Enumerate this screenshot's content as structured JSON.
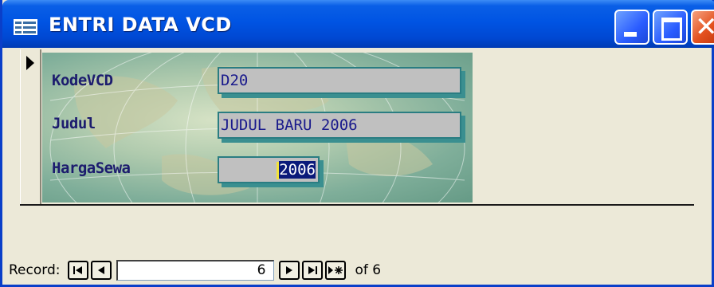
{
  "window": {
    "title": "ENTRI DATA VCD",
    "icon": "form-icon",
    "controls": [
      "minimize",
      "maximize",
      "close"
    ]
  },
  "form": {
    "fields": [
      {
        "label": "KodeVCD",
        "value": "D20"
      },
      {
        "label": "Judul",
        "value": "JUDUL BARU 2006"
      },
      {
        "label": "HargaSewa",
        "value": "2006"
      }
    ]
  },
  "navigation": {
    "label": "Record:",
    "current": "6",
    "of_text": "of 6",
    "buttons": [
      "first-record",
      "previous-record",
      "next-record",
      "last-record",
      "new-record"
    ]
  },
  "colors": {
    "titlebar": "#0054e3",
    "field_text": "#1a1a8c",
    "label_text": "#1c1c6e",
    "field_bg": "#c0c0c0",
    "selection": "#0a1a7a",
    "close_button": "#e3511f"
  }
}
